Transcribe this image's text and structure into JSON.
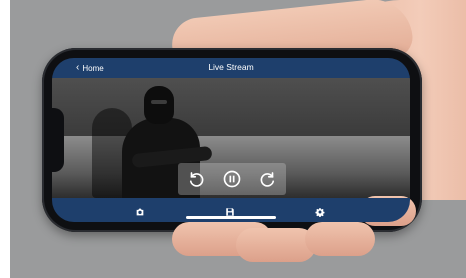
{
  "app": {
    "back_label": "Home",
    "title": "Live Stream"
  },
  "icons": {
    "back": "chevron-left-icon",
    "rewind": "rotate-ccw-icon",
    "pause": "pause-icon",
    "forward": "rotate-cw-icon",
    "snapshot": "camera-icon",
    "save": "save-icon",
    "settings": "gear-icon"
  },
  "colors": {
    "bar": "#1e3f6c",
    "icon": "#ffffff",
    "background": "#9a9b9c"
  }
}
